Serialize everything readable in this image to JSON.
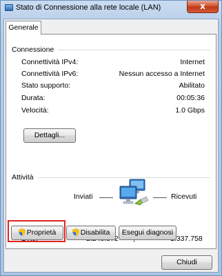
{
  "window": {
    "title": "Stato di Connessione alla rete locale (LAN)",
    "close_glyph": "x"
  },
  "tabs": [
    {
      "label": "Generale",
      "selected": true
    }
  ],
  "connection": {
    "title": "Connessione",
    "rows": [
      {
        "label": "Connettività IPv4:",
        "value": "Internet"
      },
      {
        "label": "Connettività IPv6:",
        "value": "Nessun accesso a Internet"
      },
      {
        "label": "Stato supporto:",
        "value": "Abilitato"
      },
      {
        "label": "Durata:",
        "value": "00:05:36"
      },
      {
        "label": "Velocità:",
        "value": "1.0 Gbps"
      }
    ],
    "details_button": "Dettagli..."
  },
  "activity": {
    "title": "Attività",
    "sent_label": "Inviati",
    "received_label": "Ricevuti",
    "bytes_label": "Byte:",
    "bytes_sent": "2.248.572",
    "bytes_received": "1.337.758",
    "network_icon": "network-computers-icon"
  },
  "buttons": {
    "properties": "Proprietà",
    "disable": "Disabilita",
    "diagnose": "Esegui diagnosi",
    "close": "Chiudi"
  },
  "colors": {
    "highlight": "#e0231f",
    "close_button": "#c2391b"
  }
}
